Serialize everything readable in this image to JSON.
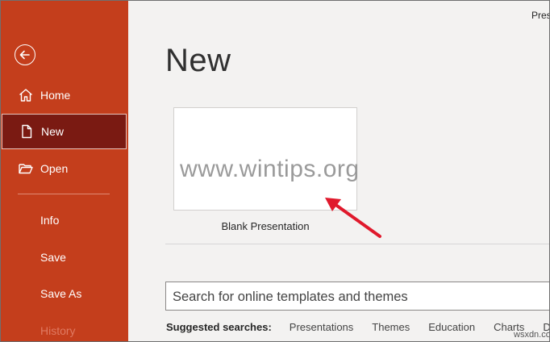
{
  "backstage": {
    "window_title": "Pres",
    "nav": [
      {
        "label": "Home",
        "icon": "home-icon"
      },
      {
        "label": "New",
        "icon": "new-document-icon",
        "selected": true
      },
      {
        "label": "Open",
        "icon": "open-folder-icon"
      },
      {
        "label": "Info"
      },
      {
        "label": "Save"
      },
      {
        "label": "Save As"
      },
      {
        "label": "History"
      }
    ]
  },
  "main": {
    "title": "New",
    "tile_label": "Blank Presentation",
    "search_placeholder": "Search for online templates and themes",
    "suggested_label": "Suggested searches:",
    "suggested": [
      "Presentations",
      "Themes",
      "Education",
      "Charts",
      "D"
    ]
  },
  "overlay": {
    "watermark": "www.wintips.org",
    "corner_watermark": "wsxdn.com",
    "arrow_color": "#e0192c"
  },
  "colors": {
    "sidebar": "#c43e1c",
    "selected": "#7a1a12",
    "background": "#f3f2f1"
  }
}
